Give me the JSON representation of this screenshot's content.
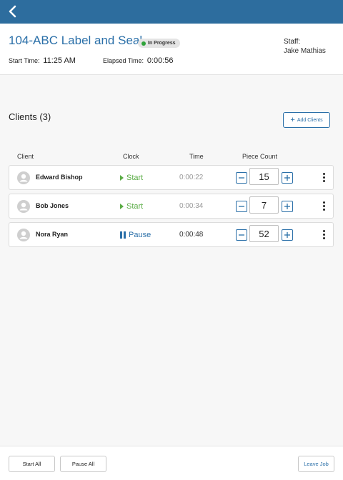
{
  "topbar": {
    "back_icon": "chevron-left-icon",
    "color": "#2d6d9e"
  },
  "job": {
    "title": "104-ABC Label and Seal",
    "status": "In Progress",
    "status_color": "#2fa33a",
    "start_time_label": "Start Time:",
    "start_time": "11:25 AM",
    "elapsed_label": "Elapsed Time:",
    "elapsed": "0:00:56",
    "staff_label": "Staff:",
    "staff_name": "Jake Mathias"
  },
  "clients": {
    "title": "Clients (3)",
    "add_button": "Add Clients",
    "columns": {
      "client": "Client",
      "clock": "Clock",
      "time": "Time",
      "piece_count": "Piece Count"
    },
    "rows": [
      {
        "name": "Edward Bishop",
        "clock": "Start",
        "time": "0:00:22",
        "piece_count": "15"
      },
      {
        "name": "Bob Jones",
        "clock": "Start",
        "time": "0:00:34",
        "piece_count": "7"
      },
      {
        "name": "Nora Ryan",
        "clock": "Pause",
        "time": "0:00:48",
        "piece_count": "52"
      }
    ]
  },
  "footer": {
    "start_all": "Start All",
    "pause_all": "Pause All",
    "leave_job": "Leave Job"
  },
  "colors": {
    "accent": "#2a6fa8",
    "start": "#5aac45"
  }
}
